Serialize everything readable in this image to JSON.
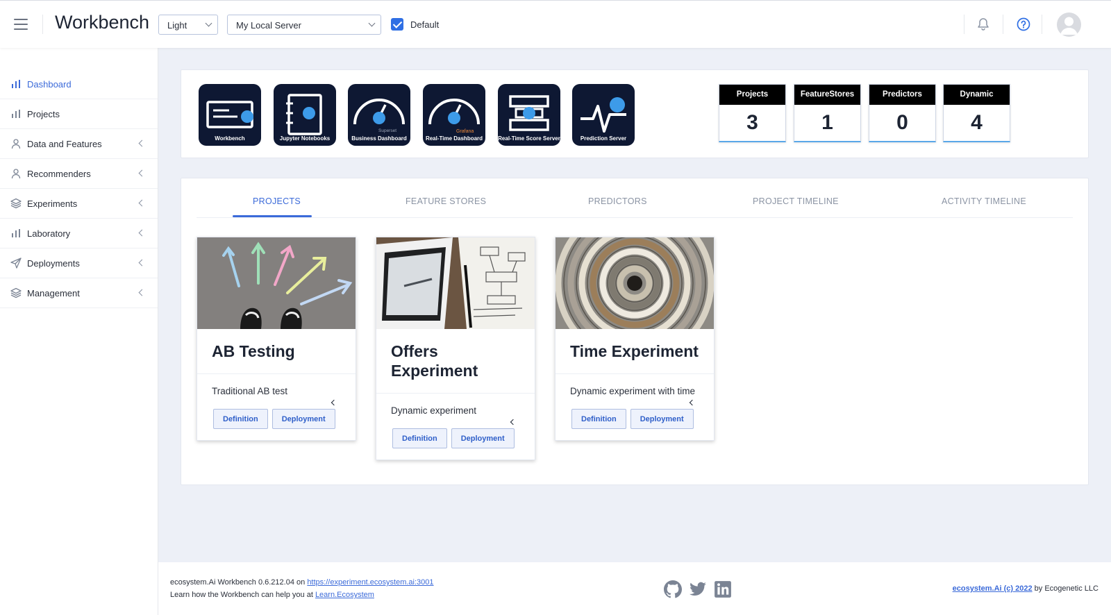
{
  "header": {
    "title": "Workbench",
    "theme_select": "Light",
    "server_select": "My Local Server",
    "default_checked": true,
    "default_label": "Default"
  },
  "sidebar": {
    "items": [
      {
        "label": "Dashboard",
        "icon": "bar-chart-icon",
        "active": true,
        "expandable": false
      },
      {
        "label": "Projects",
        "icon": "bar-chart-icon",
        "active": false,
        "expandable": false
      },
      {
        "label": "Data and Features",
        "icon": "user-icon",
        "active": false,
        "expandable": true
      },
      {
        "label": "Recommenders",
        "icon": "user-icon",
        "active": false,
        "expandable": true
      },
      {
        "label": "Experiments",
        "icon": "layers-icon",
        "active": false,
        "expandable": true
      },
      {
        "label": "Laboratory",
        "icon": "bar-chart-icon",
        "active": false,
        "expandable": true
      },
      {
        "label": "Deployments",
        "icon": "send-icon",
        "active": false,
        "expandable": true
      },
      {
        "label": "Management",
        "icon": "layers-icon",
        "active": false,
        "expandable": true
      }
    ]
  },
  "tiles": [
    {
      "label": "Workbench",
      "icon": "workbench-icon"
    },
    {
      "label": "Jupyter Notebooks",
      "icon": "notebook-icon"
    },
    {
      "label": "Business Dashboard",
      "icon": "gauge-icon",
      "badge": "Superset"
    },
    {
      "label": "Real-Time Dashboard",
      "icon": "gauge-icon",
      "badge": "Grafana"
    },
    {
      "label": "Real-Time Score Server",
      "icon": "server-icon"
    },
    {
      "label": "Prediction Server",
      "icon": "pulse-icon"
    }
  ],
  "stats": [
    {
      "label": "Projects",
      "value": "3"
    },
    {
      "label": "FeatureStores",
      "value": "1"
    },
    {
      "label": "Predictors",
      "value": "0"
    },
    {
      "label": "Dynamic",
      "value": "4"
    }
  ],
  "tabs": [
    {
      "label": "PROJECTS",
      "active": true
    },
    {
      "label": "FEATURE STORES",
      "active": false
    },
    {
      "label": "PREDICTORS",
      "active": false
    },
    {
      "label": "PROJECT TIMELINE",
      "active": false
    },
    {
      "label": "ACTIVITY TIMELINE",
      "active": false
    }
  ],
  "projects": [
    {
      "title": "AB Testing",
      "description": "Traditional AB test",
      "definition_label": "Definition",
      "deployment_label": "Deployment"
    },
    {
      "title": "Offers Experiment",
      "description": "Dynamic experiment",
      "definition_label": "Definition",
      "deployment_label": "Deployment"
    },
    {
      "title": "Time Experiment",
      "description": "Dynamic experiment with time",
      "definition_label": "Definition",
      "deployment_label": "Deployment"
    }
  ],
  "footer": {
    "version_text": "ecosystem.Ai Workbench 0.6.212.04 on",
    "server_url": "https://experiment.ecosystem.ai:3001",
    "learn_text": "Learn how the Workbench can help you at",
    "learn_link": "Learn.Ecosystem",
    "copyright_link": "ecosystem.Ai (c) 2022",
    "copyright_suffix": "by Ecogenetic LLC"
  }
}
